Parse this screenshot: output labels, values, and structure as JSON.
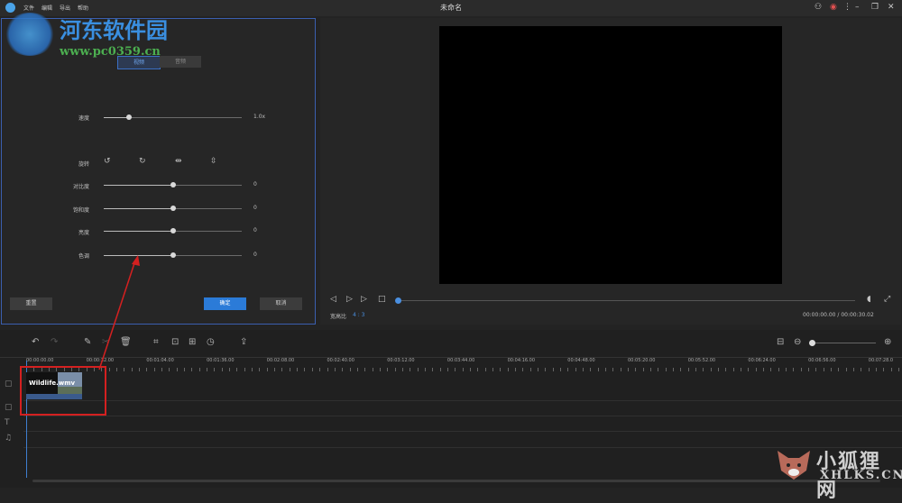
{
  "app": {
    "title": "未命名"
  },
  "menu": [
    "文件",
    "编辑",
    "导出",
    "帮助"
  ],
  "editor": {
    "tabs": {
      "video": "视频",
      "audio": "音频"
    },
    "speed": {
      "label": "速度",
      "value": "1.0x",
      "level": 0.18
    },
    "rotate_label": "旋转",
    "sliders": [
      {
        "label": "对比度",
        "value": "0",
        "level": 0.5
      },
      {
        "label": "饱和度",
        "value": "0",
        "level": 0.5
      },
      {
        "label": "亮度",
        "value": "0",
        "level": 0.5
      },
      {
        "label": "色调",
        "value": "0",
        "level": 0.5
      }
    ],
    "reset_label": "重置",
    "ok_label": "确定",
    "cancel_label": "取消"
  },
  "preview": {
    "aspect_label": "宽高比",
    "aspect_value": "4 : 3",
    "time": "00:00:00.00 / 00:00:30.02"
  },
  "timeline": {
    "ticks": [
      "00:00:00.00",
      "00:00:32.00",
      "00:01:04.00",
      "00:01:36.00",
      "00:02:08.00",
      "00:02:40.00",
      "00:03:12.00",
      "00:03:44.00",
      "00:04:16.00",
      "00:04:48.00",
      "00:05:20.00",
      "00:05:52.00",
      "00:06:24.00",
      "00:06:56.00",
      "00:07:28.0"
    ],
    "clip_label": "Wildlife.wmv"
  },
  "watermarks": {
    "top_name": "河东软件园",
    "top_url": "www.pc0359.cn",
    "bottom_name": "小狐狸网",
    "bottom_url": "XHLKS.CN"
  },
  "colors": {
    "accent": "#2b7bd8",
    "selection": "#3b5fb0",
    "annotation": "#d42020"
  }
}
